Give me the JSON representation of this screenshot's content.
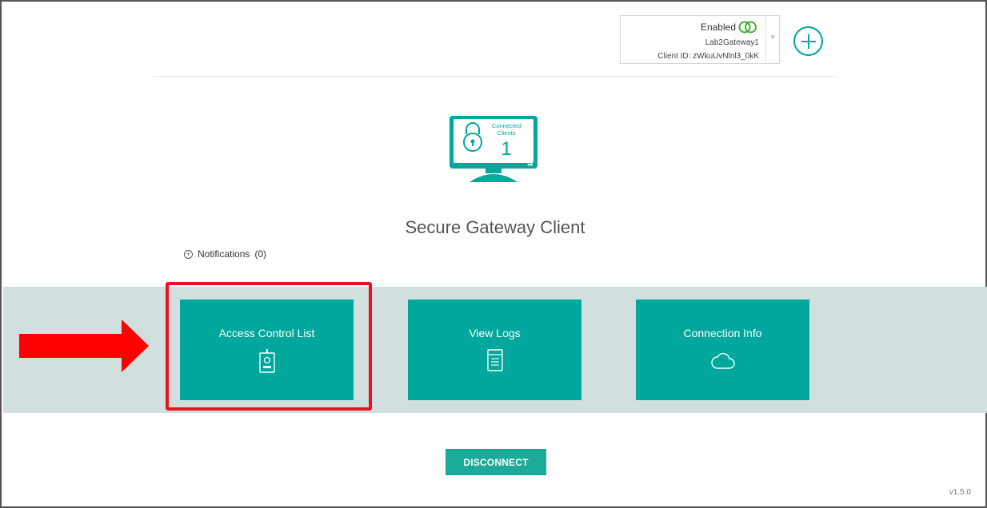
{
  "gateway": {
    "status": "Enabled",
    "name": "Lab2Gateway1",
    "client_id": "Client ID: zWkuUvNlnl3_0kK"
  },
  "monitor": {
    "label_line1": "Connected",
    "label_line2": "Clients",
    "count": "1"
  },
  "title": "Secure Gateway Client",
  "notifications": {
    "label": "Notifications",
    "count": "(0)"
  },
  "tiles": [
    {
      "label": "Access Control List",
      "icon": "id-badge-icon"
    },
    {
      "label": "View Logs",
      "icon": "log-document-icon"
    },
    {
      "label": "Connection Info",
      "icon": "cloud-icon"
    }
  ],
  "actions": {
    "disconnect": "DISCONNECT"
  },
  "version": "v1.5.0",
  "colors": {
    "accent": "#00a79d",
    "band": "#d1e0df",
    "highlight": "#e8141b",
    "status_rings": "#3dae2b"
  }
}
